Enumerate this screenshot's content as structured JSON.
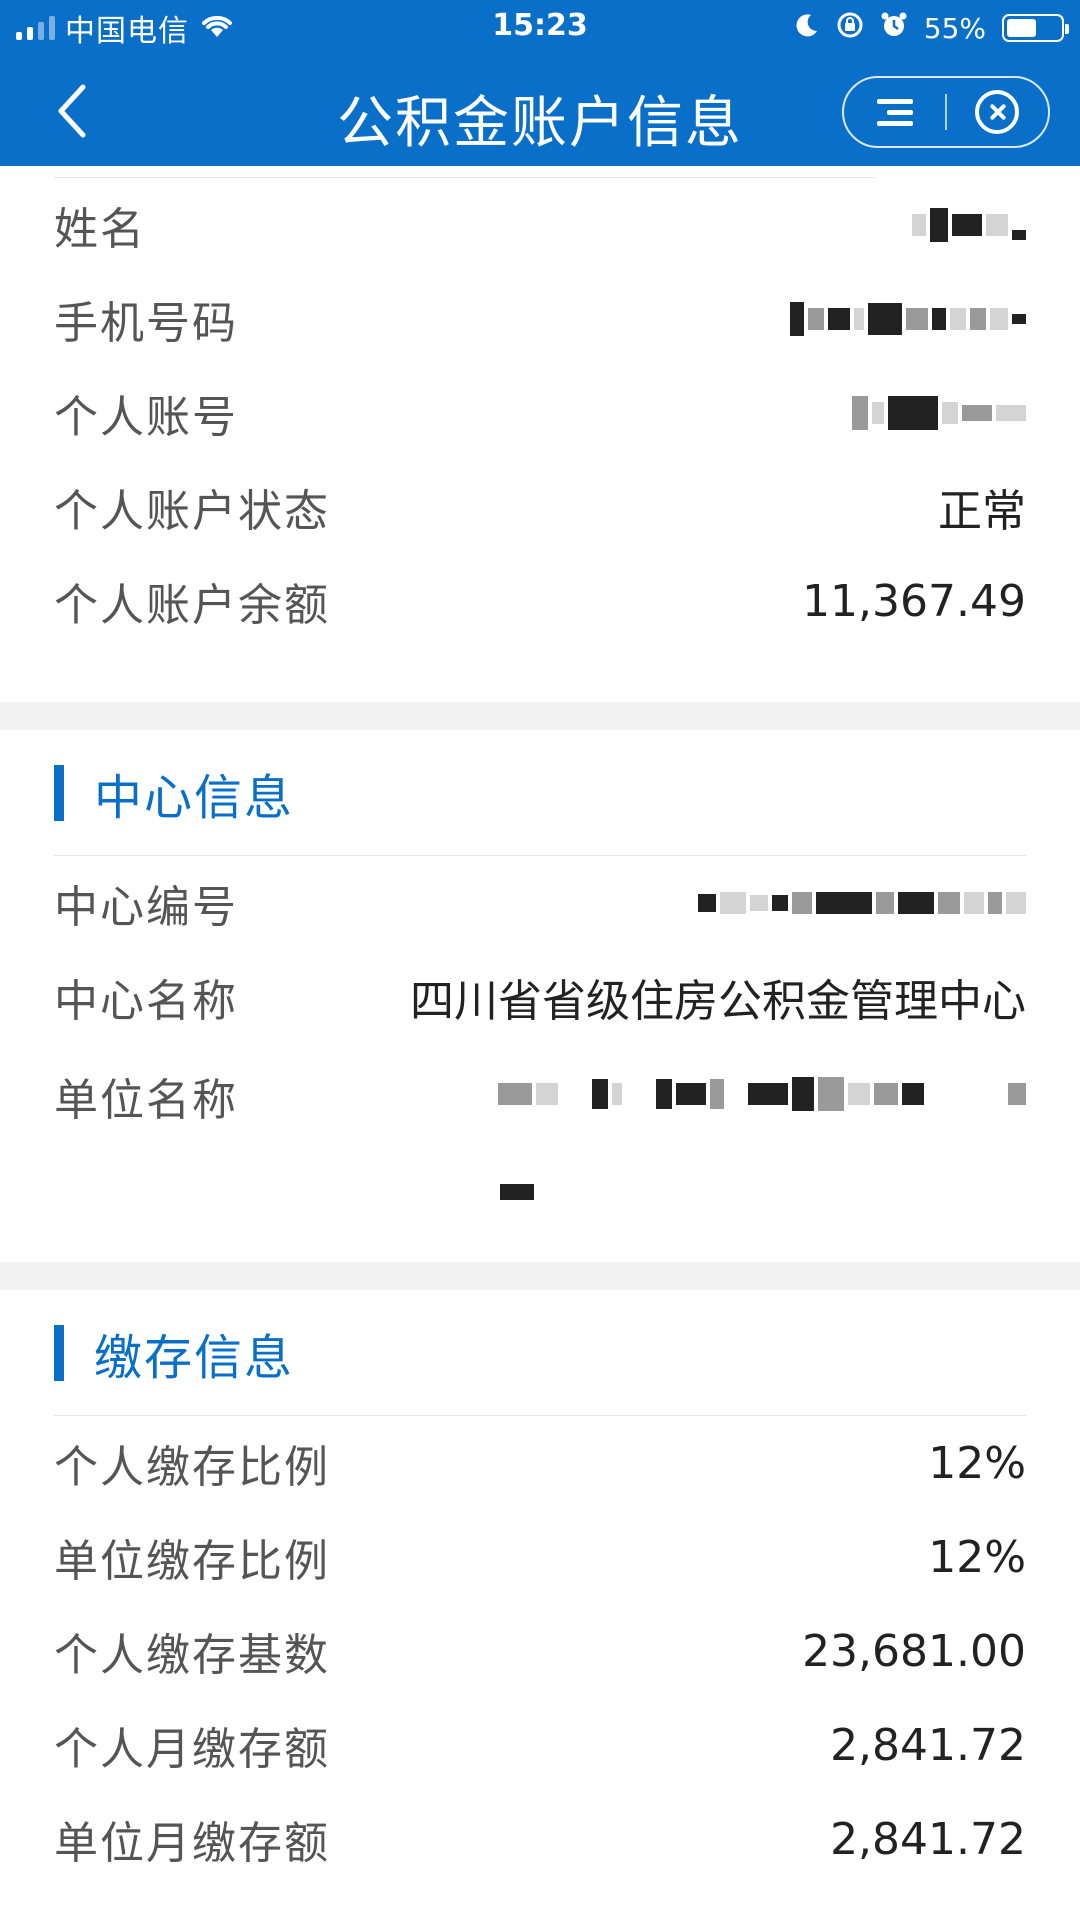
{
  "status_bar": {
    "carrier": "中国电信",
    "time": "15:23",
    "battery_percent": "55%",
    "battery_level": 0.55,
    "icons": [
      "signal-icon",
      "wifi-icon",
      "moon-icon",
      "rotation-lock-icon",
      "alarm-icon",
      "battery-icon"
    ]
  },
  "header": {
    "title": "公积金账户信息",
    "back_icon": "chevron-left-icon",
    "menu_icon": "menu-icon",
    "close_icon": "close-circle-icon"
  },
  "personal": {
    "rows": [
      {
        "label": "姓名",
        "value": ""
      },
      {
        "label": "手机号码",
        "value": ""
      },
      {
        "label": "个人账号",
        "value": ""
      },
      {
        "label": "个人账户状态",
        "value": "正常"
      },
      {
        "label": "个人账户余额",
        "value": "11,367.49"
      }
    ]
  },
  "center": {
    "heading": "中心信息",
    "rows": [
      {
        "label": "中心编号",
        "value": ""
      },
      {
        "label": "中心名称",
        "value": "四川省省级住房公积金管理中心"
      },
      {
        "label": "单位名称",
        "value": ""
      }
    ]
  },
  "deposit": {
    "heading": "缴存信息",
    "rows": [
      {
        "label": "个人缴存比例",
        "value": "12%"
      },
      {
        "label": "单位缴存比例",
        "value": "12%"
      },
      {
        "label": "个人缴存基数",
        "value": "23,681.00"
      },
      {
        "label": "个人月缴存额",
        "value": "2,841.72"
      },
      {
        "label": "单位月缴存额",
        "value": "2,841.72"
      }
    ]
  },
  "colors": {
    "brand_blue": "#0a6fc9",
    "background": "#ffffff",
    "divider": "#f2f2f2"
  }
}
